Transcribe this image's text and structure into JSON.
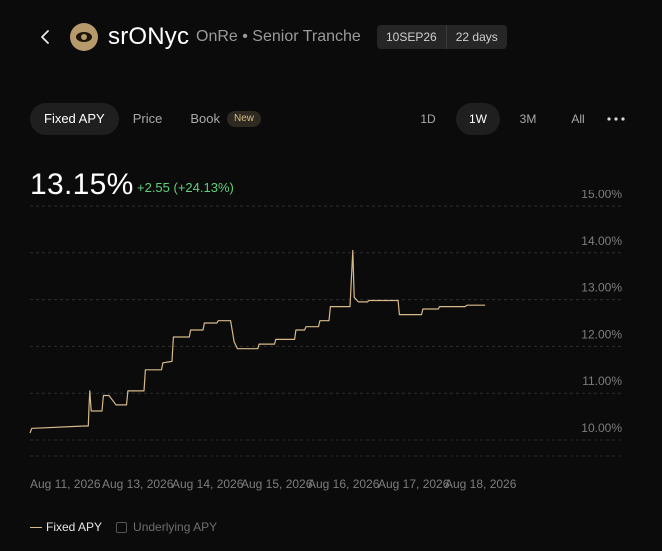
{
  "header": {
    "ticker": "srONyc",
    "subtitle": "OnRe • Senior Tranche",
    "badges": [
      "10SEP26",
      "22 days"
    ]
  },
  "tabs": [
    {
      "label": "Fixed APY",
      "active": true
    },
    {
      "label": "Price",
      "active": false
    },
    {
      "label": "Book",
      "active": false,
      "tag": "New"
    }
  ],
  "ranges": [
    {
      "label": "1D",
      "active": false
    },
    {
      "label": "1W",
      "active": true
    },
    {
      "label": "3M",
      "active": false
    },
    {
      "label": "All",
      "active": false
    }
  ],
  "summary": {
    "value": "13.15%",
    "change": "+2.55 (+24.13%)"
  },
  "legend": {
    "series1": "Fixed APY",
    "series2": "Underlying APY"
  },
  "colors": {
    "line": "#d7b98a",
    "positive": "#5fd07a",
    "background": "#0b0b0b"
  },
  "chart_data": {
    "type": "line",
    "y_ticks": [
      "15.00%",
      "14.00%",
      "13.00%",
      "12.00%",
      "11.00%",
      "10.00%"
    ],
    "y_tick_values": [
      15,
      14,
      13,
      12,
      11,
      10
    ],
    "ylim": [
      9.7,
      15.3
    ],
    "x_tick_labels": [
      "Aug 11, 2026",
      "Aug 13, 2026",
      "Aug 14, 2026",
      "Aug 15, 2026",
      "Aug 16, 2026",
      "Aug 17, 2026",
      "Aug 18, 2026"
    ],
    "x_tick_days": [
      11,
      13,
      14,
      15,
      16,
      17,
      18
    ],
    "xlim": [
      11,
      18.75
    ],
    "series": [
      {
        "name": "Fixed APY",
        "points": [
          [
            11.0,
            10.15
          ],
          [
            11.05,
            10.25
          ],
          [
            11.1,
            10.25
          ],
          [
            12.5,
            10.3
          ],
          [
            12.62,
            10.3
          ],
          [
            12.64,
            10.7
          ],
          [
            12.66,
            11.05
          ],
          [
            12.7,
            10.62
          ],
          [
            13.0,
            10.62
          ],
          [
            13.02,
            10.95
          ],
          [
            13.1,
            10.95
          ],
          [
            13.15,
            10.85
          ],
          [
            13.2,
            10.75
          ],
          [
            13.35,
            10.75
          ],
          [
            13.37,
            11.05
          ],
          [
            13.6,
            11.05
          ],
          [
            13.62,
            11.5
          ],
          [
            13.85,
            11.5
          ],
          [
            13.87,
            11.65
          ],
          [
            14.0,
            11.68
          ],
          [
            14.02,
            12.2
          ],
          [
            14.25,
            12.2
          ],
          [
            14.27,
            12.35
          ],
          [
            14.45,
            12.35
          ],
          [
            14.47,
            12.5
          ],
          [
            14.65,
            12.5
          ],
          [
            14.67,
            12.55
          ],
          [
            14.85,
            12.55
          ],
          [
            14.9,
            12.1
          ],
          [
            14.95,
            11.95
          ],
          [
            15.25,
            11.95
          ],
          [
            15.27,
            12.05
          ],
          [
            15.5,
            12.05
          ],
          [
            15.52,
            12.15
          ],
          [
            15.8,
            12.15
          ],
          [
            15.82,
            12.35
          ],
          [
            15.95,
            12.35
          ],
          [
            15.97,
            12.42
          ],
          [
            16.15,
            12.42
          ],
          [
            16.17,
            12.55
          ],
          [
            16.3,
            12.55
          ],
          [
            16.32,
            12.85
          ],
          [
            16.6,
            12.85
          ],
          [
            16.64,
            14.05
          ],
          [
            16.66,
            13.05
          ],
          [
            16.72,
            12.95
          ],
          [
            16.85,
            12.95
          ],
          [
            16.87,
            12.98
          ],
          [
            17.3,
            12.98
          ],
          [
            17.32,
            12.68
          ],
          [
            17.65,
            12.68
          ],
          [
            17.67,
            12.8
          ],
          [
            17.9,
            12.8
          ],
          [
            17.92,
            12.85
          ],
          [
            18.2,
            12.85
          ],
          [
            18.22,
            12.88
          ],
          [
            18.4,
            12.88
          ]
        ]
      }
    ],
    "end_value": 12.88,
    "grid": "horizontal dashed",
    "legend_position": "bottom-left"
  }
}
